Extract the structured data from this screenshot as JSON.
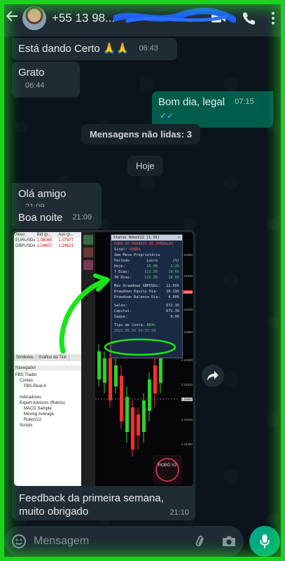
{
  "header": {
    "back_icon": "arrow-left-icon",
    "contact_name": "+55 13 98...",
    "icons": [
      "video-call-icon",
      "phone-icon",
      "more-vertical-icon"
    ]
  },
  "messages": [
    {
      "text": "Está dando  Certo 🙏🙏",
      "time": "06:43",
      "direction": "in"
    },
    {
      "text": "Grato",
      "time": "06:44",
      "direction": "in"
    },
    {
      "text": "Bom dia, legal",
      "time": "07:15",
      "direction": "out",
      "read": true
    },
    {
      "text": "Olá amigo",
      "time": "21:09",
      "direction": "in"
    },
    {
      "text": "Boa noite",
      "time": "21:09",
      "direction": "in"
    }
  ],
  "unread_label": "Mensagens não lidas: 3",
  "date_label": "Hoje",
  "image_message": {
    "caption": "Feedback da primeira semana, muito obrigado",
    "time": "21:10",
    "screenshot": {
      "market_watch": {
        "headers": [
          "Ativo",
          "Bid (p...",
          "Ask (p..."
        ],
        "rows": [
          [
            "EURUSDx",
            "1.08065",
            "1.07977"
          ],
          [
            "GBPUSDx",
            "1.24607",
            "1.24621"
          ]
        ],
        "tabs": [
          "Símbolos",
          "Gráfico de Tick"
        ]
      },
      "navigator": {
        "title": "Navegador",
        "items": [
          "FBS Trader",
          "Contas",
          "FBS-Real-4",
          "Indicadores",
          "Expert Advisors (Robôs)",
          "MACD Sample",
          "Moving Average",
          "RoboV12",
          "Scripts"
        ]
      },
      "status_panel": {
        "title": "Status RoboV12 [1.10]",
        "fora": "FORA DO HORÁRIO DE OPERAÇÃO",
        "sinal_label": "Sinal:",
        "sinal_value": "VENDA",
        "mesa": "Sem Mesa Proprietária",
        "table_headers": [
          "Período",
          "Lucro",
          "(%)"
        ],
        "table_rows": [
          [
            "Hoje:",
            "15.00",
            "2.2%"
          ],
          [
            "7 Dias:",
            "122.39",
            "18.6%"
          ],
          [
            "30 Dias:",
            "122.39",
            "18.6%"
          ]
        ],
        "drawdowns": [
          [
            "Max Drawdown GBPUSDx:",
            "11.99%"
          ],
          [
            "Drawdown Equity Dia:",
            "10.19%"
          ],
          [
            "Drawdown Balance Dia:",
            "0.00%"
          ]
        ],
        "saldo_label": "Saldo:",
        "saldo_value": "672.39",
        "capital_label": "Capital:",
        "capital_value": "672.39",
        "saque_label": "Saque:",
        "saque_value": "0.00",
        "tipo_label": "Tipo de Conta:",
        "tipo_value": "REAL",
        "date": "2023.09.05 00:37:58"
      },
      "price_axis": [
        "1.24650",
        "1.24630",
        "1.24618",
        "1.24600",
        "1.24580",
        "1.24560",
        "1.24540",
        "1.24507",
        "1.24500",
        "1.24480"
      ],
      "logo_text": "ROBÔ V2"
    }
  },
  "input": {
    "placeholder": "Mensagem",
    "icons": [
      "emoji-icon",
      "attach-icon",
      "camera-icon",
      "mic-icon"
    ]
  },
  "colors": {
    "incoming_bubble": "#202c33",
    "outgoing_bubble": "#005c4b",
    "read_ticks": "#53bdeb",
    "accent": "#00a884",
    "frame_glow": "#1fd11f"
  }
}
